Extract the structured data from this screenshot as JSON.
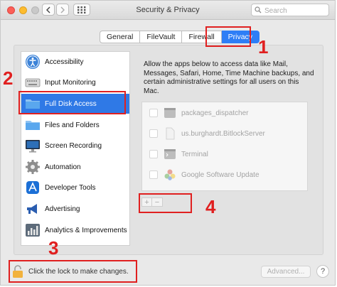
{
  "window": {
    "title": "Security & Privacy",
    "search_placeholder": "Search"
  },
  "tabs": [
    {
      "label": "General",
      "active": false
    },
    {
      "label": "FileVault",
      "active": false
    },
    {
      "label": "Firewall",
      "active": false
    },
    {
      "label": "Privacy",
      "active": true
    }
  ],
  "sidebar": {
    "items": [
      {
        "label": "Accessibility",
        "icon": "accessibility-icon",
        "selected": false
      },
      {
        "label": "Input Monitoring",
        "icon": "keyboard-icon",
        "selected": false
      },
      {
        "label": "Full Disk Access",
        "icon": "folder-icon",
        "selected": true
      },
      {
        "label": "Files and Folders",
        "icon": "folder-icon",
        "selected": false
      },
      {
        "label": "Screen Recording",
        "icon": "display-icon",
        "selected": false
      },
      {
        "label": "Automation",
        "icon": "gear-icon",
        "selected": false
      },
      {
        "label": "Developer Tools",
        "icon": "developer-tools-icon",
        "selected": false
      },
      {
        "label": "Advertising",
        "icon": "megaphone-icon",
        "selected": false
      },
      {
        "label": "Analytics & Improvements",
        "icon": "bar-chart-icon",
        "selected": false
      }
    ]
  },
  "main": {
    "description": "Allow the apps below to access data like Mail, Messages, Safari, Home, Time Machine backups, and certain administrative settings for all users on this Mac.",
    "apps": [
      {
        "label": "packages_dispatcher",
        "icon": "terminal-app-icon",
        "checked": false
      },
      {
        "label": "us.burghardt.BitlockServer",
        "icon": "document-icon",
        "checked": false
      },
      {
        "label": "Terminal",
        "icon": "terminal-app-icon",
        "checked": false
      },
      {
        "label": "Google Software Update",
        "icon": "google-update-icon",
        "checked": false
      }
    ],
    "add_label": "+",
    "remove_label": "−"
  },
  "footer": {
    "lock_label": "Click the lock to make changes.",
    "advanced_label": "Advanced...",
    "help_label": "?"
  },
  "annotations": {
    "one": "1",
    "two": "2",
    "three": "3",
    "four": "4",
    "color": "#e02020"
  },
  "colors": {
    "accent": "#2e7ef6",
    "selection": "#2f79e6"
  }
}
